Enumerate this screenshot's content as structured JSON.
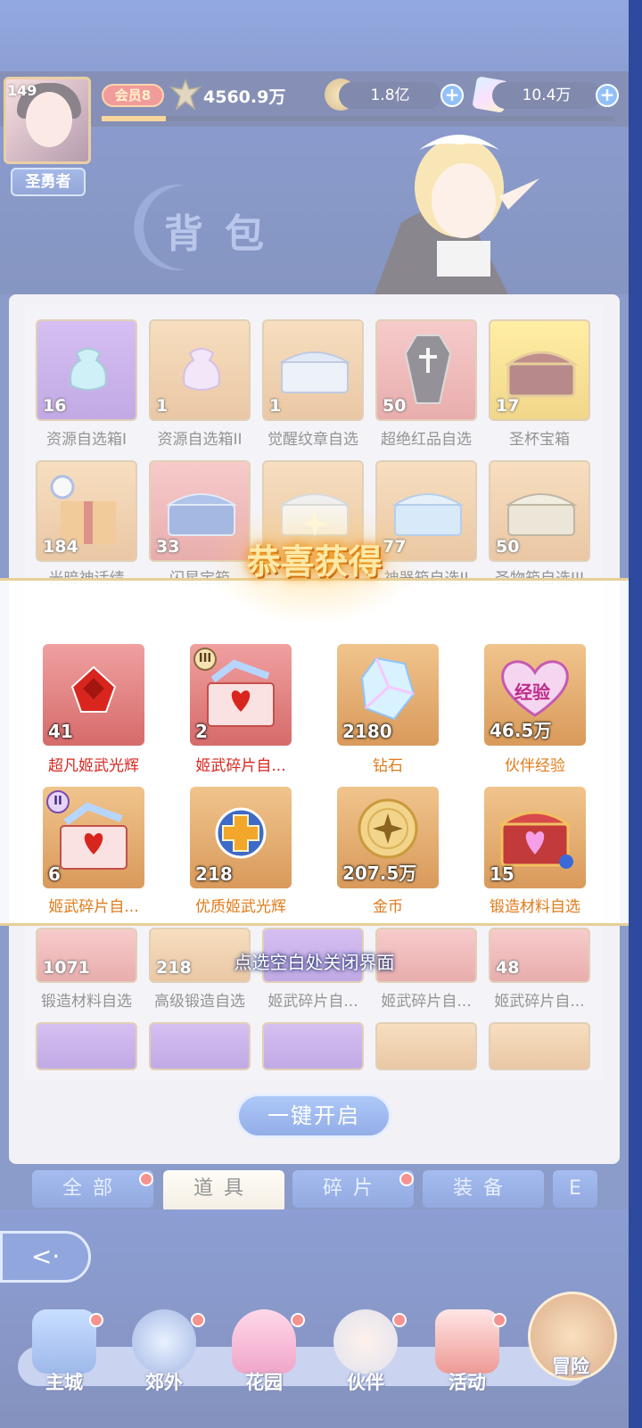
{
  "header": {
    "level": "149",
    "title_badge": "圣勇者",
    "vip": "会员8",
    "power": "4560.9万",
    "gold": "1.8亿",
    "diamond": "10.4万",
    "page_title": "背包"
  },
  "bag_rows": [
    [
      {
        "count": "16",
        "label": "资源自选箱I",
        "color": "purple"
      },
      {
        "count": "1",
        "label": "资源自选箱II",
        "color": "orange"
      },
      {
        "count": "1",
        "label": "觉醒纹章自选",
        "color": "orange"
      },
      {
        "count": "50",
        "label": "超绝红品自选",
        "color": "red"
      },
      {
        "count": "17",
        "label": "圣杯宝箱",
        "color": "gold"
      }
    ],
    [
      {
        "count": "184",
        "label": "光暗神话绩",
        "color": "orange"
      },
      {
        "count": "33",
        "label": "闪星宝箱",
        "color": "red"
      },
      {
        "count": "",
        "label": "",
        "color": "orange"
      },
      {
        "count": "77",
        "label": "神器箱自选II",
        "color": "orange"
      },
      {
        "count": "50",
        "label": "圣物箱自选III",
        "color": "orange"
      }
    ],
    [
      {
        "count": "1071",
        "label": "锻造材料自选",
        "color": "red"
      },
      {
        "count": "218",
        "label": "高级锻造自选",
        "color": "orange"
      },
      {
        "count": "",
        "label": "姬武碎片自...",
        "color": "purple"
      },
      {
        "count": "",
        "label": "姬武碎片自...",
        "color": "red"
      },
      {
        "count": "48",
        "label": "姬武碎片自...",
        "color": "red"
      }
    ]
  ],
  "onekey": "一键开启",
  "tabs": [
    {
      "label": "全部",
      "dot": true
    },
    {
      "label": "道具",
      "dot": false,
      "active": true
    },
    {
      "label": "碎片",
      "dot": true
    },
    {
      "label": "装备",
      "dot": false
    },
    {
      "label": "E",
      "dot": false
    }
  ],
  "popup": {
    "title": "恭喜获得",
    "hint": "点选空白处关闭界面",
    "items": [
      {
        "count": "41",
        "label": "超凡姬武光辉",
        "color": "red",
        "label_color": "red",
        "icon": "red-gem-icon"
      },
      {
        "count": "2",
        "label": "姬武碎片自...",
        "color": "red",
        "label_color": "red",
        "icon": "heart-chest-icon",
        "badge": "III"
      },
      {
        "count": "2180",
        "label": "钻石",
        "color": "orange",
        "label_color": "orange",
        "icon": "diamond-icon"
      },
      {
        "count": "46.5万",
        "label": "伙伴经验",
        "color": "orange",
        "label_color": "orange",
        "icon": "exp-heart-icon",
        "badge_text": "经验"
      },
      {
        "count": "6",
        "label": "姬武碎片自...",
        "color": "orange",
        "label_color": "orange",
        "icon": "heart-chest-icon",
        "badge": "II"
      },
      {
        "count": "218",
        "label": "优质姬武光辉",
        "color": "orange",
        "label_color": "orange",
        "icon": "gold-cross-gem-icon"
      },
      {
        "count": "207.5万",
        "label": "金币",
        "color": "orange",
        "label_color": "orange",
        "icon": "gold-coin-icon"
      },
      {
        "count": "15",
        "label": "锻造材料自选",
        "color": "orange",
        "label_color": "orange",
        "icon": "forge-chest-icon"
      }
    ]
  },
  "nav": [
    {
      "label": "主城",
      "icon": "castle-icon"
    },
    {
      "label": "郊外",
      "icon": "compass-icon"
    },
    {
      "label": "花园",
      "icon": "heart-garden-icon"
    },
    {
      "label": "伙伴",
      "icon": "partner-icon"
    },
    {
      "label": "活动",
      "icon": "gift-icon"
    },
    {
      "label": "冒险",
      "icon": "sword-icon"
    }
  ]
}
